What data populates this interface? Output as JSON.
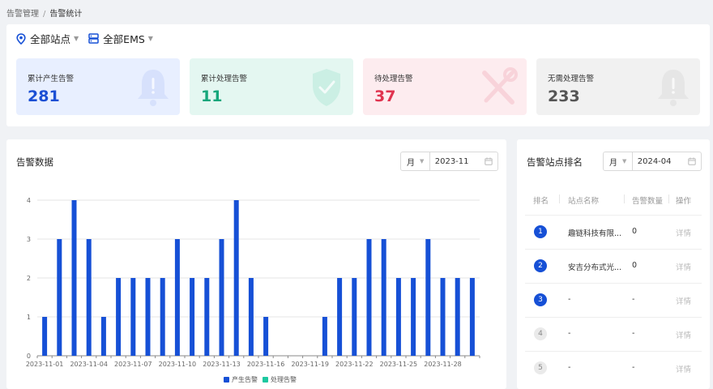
{
  "breadcrumb": {
    "parent": "告警管理",
    "separator": "/",
    "current": "告警统计"
  },
  "filters": {
    "site": "全部站点",
    "ems": "全部EMS"
  },
  "colors": {
    "primary": "#1650d6",
    "processed": "#1dc8a0"
  },
  "cards": [
    {
      "label": "累计产生告警",
      "value": "281",
      "icon": "bell-icon"
    },
    {
      "label": "累计处理告警",
      "value": "11",
      "icon": "shield-check-icon"
    },
    {
      "label": "待处理告警",
      "value": "37",
      "icon": "tools-icon"
    },
    {
      "label": "无需处理告警",
      "value": "233",
      "icon": "bell-muted-icon"
    }
  ],
  "chart_panel": {
    "title": "告警数据",
    "unit": "月",
    "date": "2023-11"
  },
  "chart_data": {
    "type": "bar",
    "x": [
      "2023-11-01",
      "2023-11-02",
      "2023-11-03",
      "2023-11-04",
      "2023-11-05",
      "2023-11-06",
      "2023-11-07",
      "2023-11-08",
      "2023-11-09",
      "2023-11-10",
      "2023-11-11",
      "2023-11-12",
      "2023-11-13",
      "2023-11-14",
      "2023-11-15",
      "2023-11-16",
      "2023-11-17",
      "2023-11-18",
      "2023-11-19",
      "2023-11-20",
      "2023-11-21",
      "2023-11-22",
      "2023-11-23",
      "2023-11-24",
      "2023-11-25",
      "2023-11-26",
      "2023-11-27",
      "2023-11-28",
      "2023-11-29",
      "2023-11-30"
    ],
    "xticks": [
      "2023-11-01",
      "2023-11-04",
      "2023-11-07",
      "2023-11-10",
      "2023-11-13",
      "2023-11-16",
      "2023-11-19",
      "2023-11-22",
      "2023-11-25",
      "2023-11-28"
    ],
    "series": [
      {
        "name": "产生告警",
        "color": "#1650d6",
        "values": [
          1,
          3,
          4,
          3,
          1,
          2,
          2,
          2,
          2,
          3,
          2,
          2,
          3,
          4,
          2,
          1,
          0,
          0,
          0,
          1,
          2,
          2,
          3,
          3,
          2,
          2,
          3,
          2,
          2,
          2
        ]
      },
      {
        "name": "处理告警",
        "color": "#1dc8a0",
        "values": [
          0,
          0,
          0,
          0,
          0,
          0,
          0,
          0,
          0,
          0,
          0,
          0,
          0,
          0,
          0,
          0,
          0,
          0,
          0,
          0,
          0,
          0,
          0,
          0,
          0,
          0,
          0,
          0,
          0,
          0
        ]
      }
    ],
    "yticks": [
      "0",
      "1",
      "2",
      "3",
      "4"
    ],
    "ylim": [
      0,
      4
    ],
    "grid": true,
    "legend": "bottom"
  },
  "rank_panel": {
    "title": "告警站点排名",
    "unit": "月",
    "date": "2024-04",
    "columns": [
      "排名",
      "站点名称",
      "告警数量",
      "操作"
    ],
    "rows": [
      {
        "rank": "1",
        "site": "趣链科技有限...",
        "count": "0",
        "action": "详情"
      },
      {
        "rank": "2",
        "site": "安吉分布式光...",
        "count": "0",
        "action": "详情"
      },
      {
        "rank": "3",
        "site": "-",
        "count": "-",
        "action": "详情"
      },
      {
        "rank": "4",
        "site": "-",
        "count": "-",
        "action": "详情"
      },
      {
        "rank": "5",
        "site": "-",
        "count": "-",
        "action": "详情"
      }
    ]
  }
}
